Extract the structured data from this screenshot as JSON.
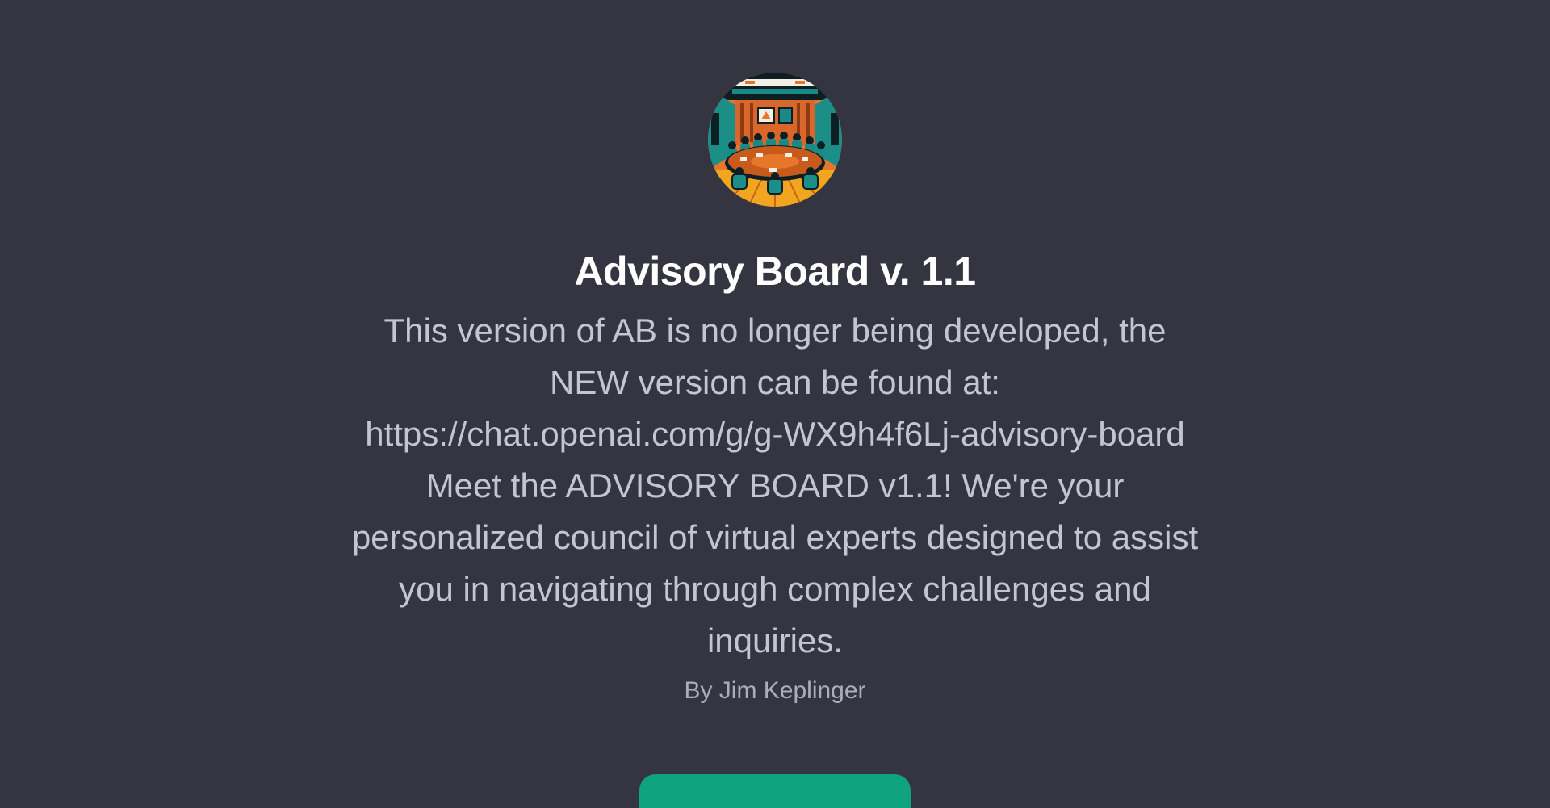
{
  "gpt": {
    "title": "Advisory Board v. 1.1",
    "description": "This version of AB is no longer being developed, the NEW version can be found at: https://chat.openai.com/g/g-WX9h4f6Lj-advisory-board Meet the ADVISORY BOARD v1.1! We're your personalized council of virtual experts designed to assist you in navigating through complex challenges and inquiries.",
    "author": "By Jim Keplinger"
  },
  "avatar": {
    "icon": "boardroom-meeting-illustration"
  },
  "colors": {
    "background": "#343541",
    "title": "#ffffff",
    "description": "#c5c5d2",
    "author": "#acacbe",
    "button": "#10a37f"
  }
}
